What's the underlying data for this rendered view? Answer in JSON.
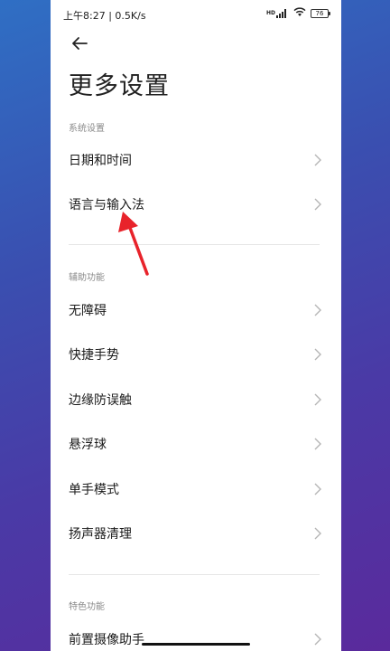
{
  "status_bar": {
    "time_speed": "上午8:27 | 0.5K/s",
    "network": "HD",
    "battery": "76"
  },
  "page_title": "更多设置",
  "sections": [
    {
      "header": "系统设置",
      "items": [
        "日期和时间",
        "语言与输入法"
      ]
    },
    {
      "header": "辅助功能",
      "items": [
        "无障碍",
        "快捷手势",
        "边缘防误触",
        "悬浮球",
        "单手模式",
        "扬声器清理"
      ]
    },
    {
      "header": "特色功能",
      "items": [
        "前置摄像助手"
      ]
    }
  ],
  "colors": {
    "annotation_arrow": "#e8232b",
    "chevron": "#b5b5b5"
  }
}
